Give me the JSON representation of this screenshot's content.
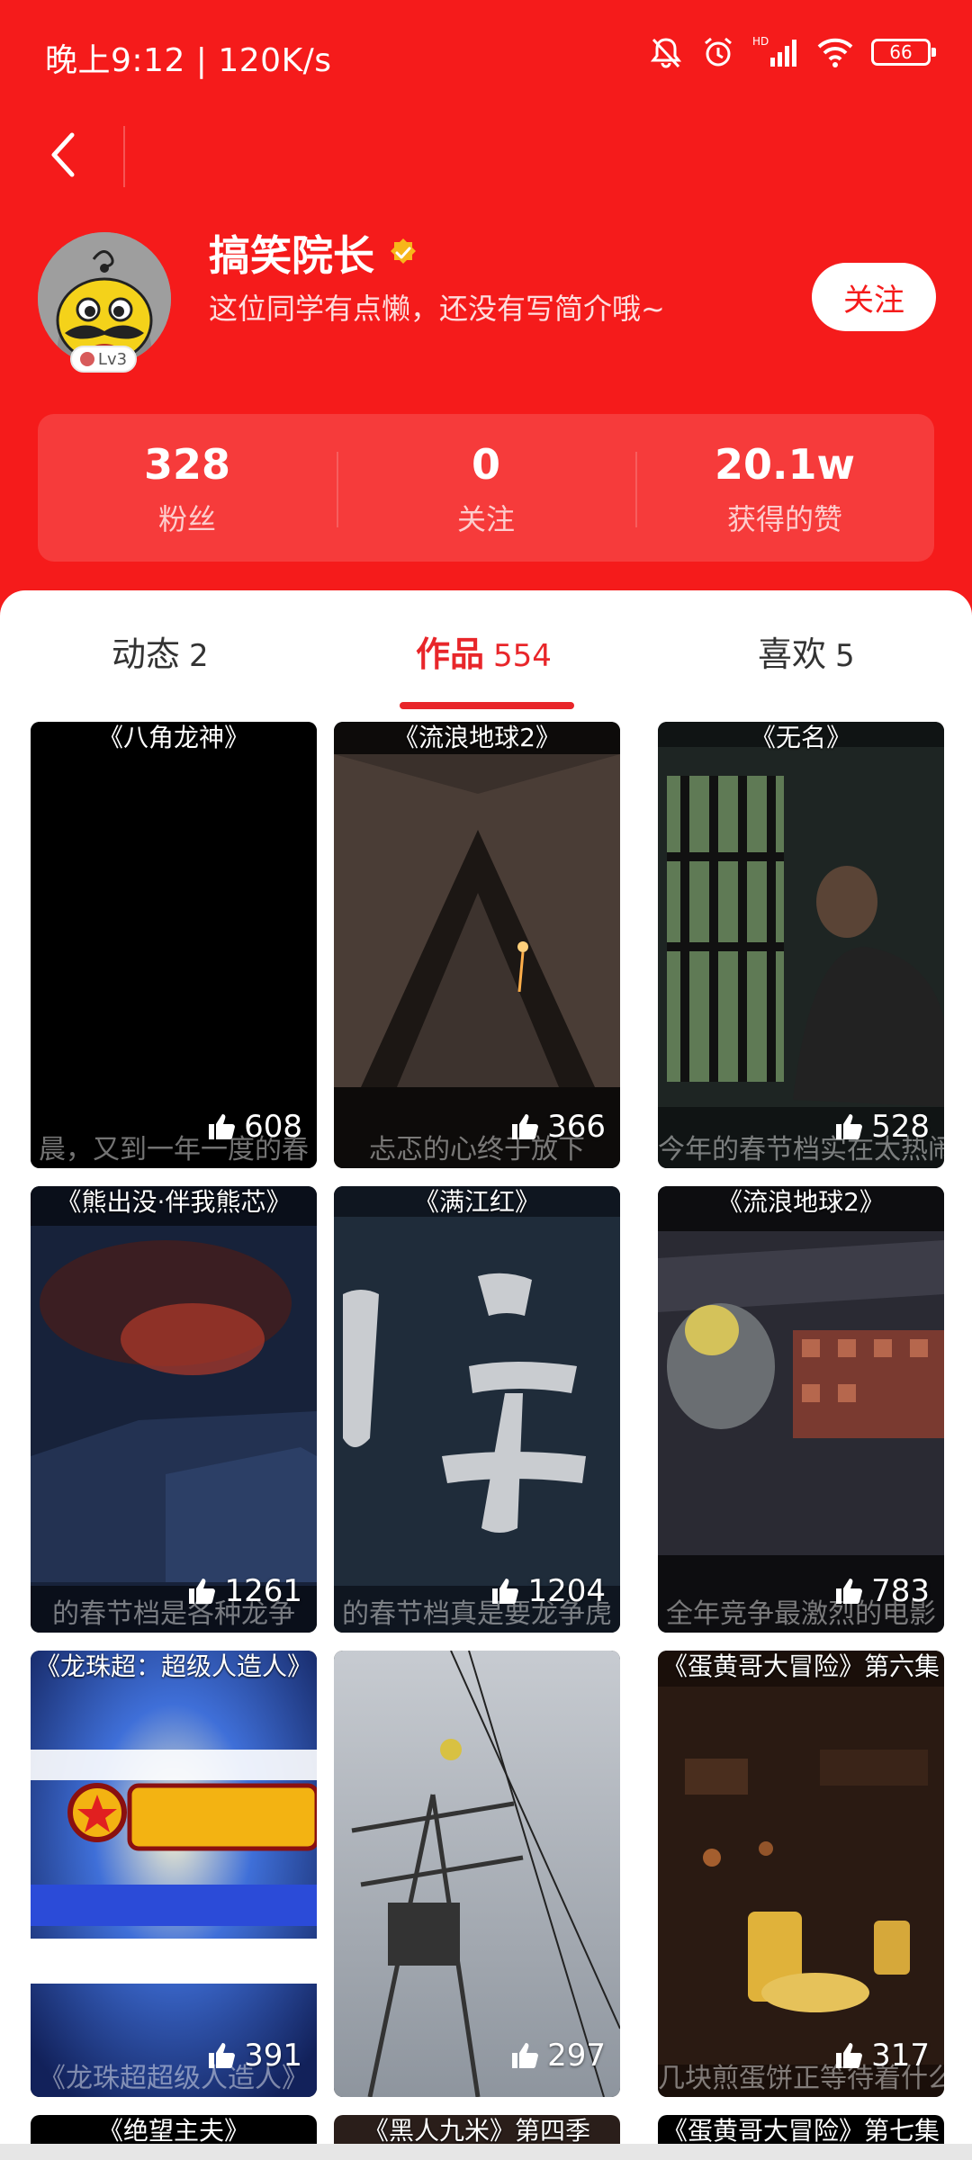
{
  "status_bar": {
    "time": "晚上9:12 | 120K/s",
    "battery": "66",
    "icons": [
      "mute-bell-icon",
      "alarm-icon",
      "hd-signal-icon",
      "wifi-icon",
      "battery-icon"
    ]
  },
  "nav": {
    "back_icon": "chevron-left-icon"
  },
  "profile": {
    "name": "搞笑院长",
    "bio": "这位同学有点懒，还没有写简介哦~",
    "level": "Lv3",
    "follow_label": "关注",
    "verified_icon": "verified-badge-icon"
  },
  "stats": [
    {
      "value": "328",
      "label": "粉丝"
    },
    {
      "value": "0",
      "label": "关注"
    },
    {
      "value": "20.1w",
      "label": "获得的赞"
    }
  ],
  "tabs": [
    {
      "label": "动态",
      "count": "2"
    },
    {
      "label": "作品",
      "count": "554"
    },
    {
      "label": "喜欢",
      "count": "5"
    }
  ],
  "videos": [
    {
      "title": "《八角龙神》",
      "caption": "晨，又到一年一度的春",
      "likes": "608"
    },
    {
      "title": "《流浪地球2》",
      "caption": "忐忑的心终于放下",
      "likes": "366"
    },
    {
      "title": "《无名》",
      "caption": "今年的春节档实在太热闹了",
      "likes": "528"
    },
    {
      "title": "《熊出没·伴我熊芯》",
      "caption": "的春节档是各种龙争",
      "likes": "1261"
    },
    {
      "title": "《满江红》",
      "caption": "的春节档真是要龙争虎",
      "likes": "1204"
    },
    {
      "title": "《流浪地球2》",
      "caption": "全年竞争最激烈的电影",
      "likes": "783"
    },
    {
      "title": "《龙珠超：超级人造人》",
      "caption": "《龙珠超超级人造人》",
      "likes": "391"
    },
    {
      "title": "",
      "caption": "",
      "likes": "297"
    },
    {
      "title": "《蛋黄哥大冒险》第六集",
      "caption": "几块煎蛋饼正等待着什么",
      "likes": "317"
    },
    {
      "title": "《绝望主夫》",
      "caption": "",
      "likes": ""
    },
    {
      "title": "《黑人九米》第四季",
      "caption": "",
      "likes": ""
    },
    {
      "title": "《蛋黄哥大冒险》第七集",
      "caption": "",
      "likes": ""
    }
  ],
  "colors": {
    "accent": "#f51b1b",
    "tab_active": "#e8262a"
  }
}
